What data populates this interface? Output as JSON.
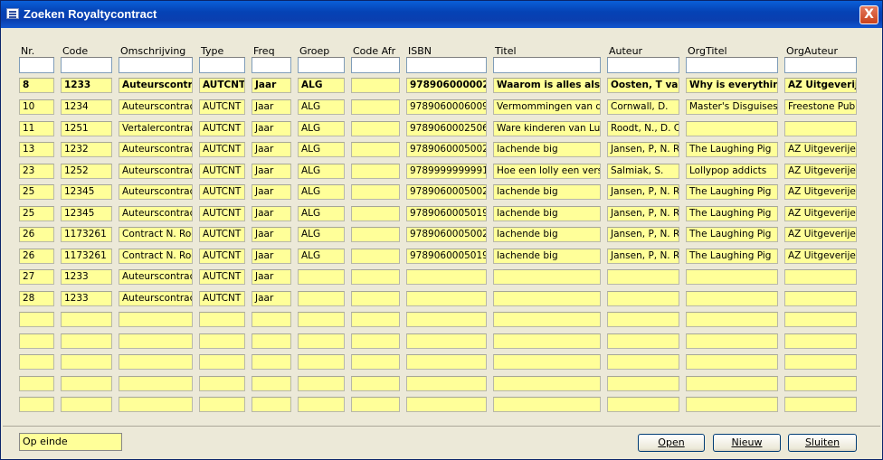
{
  "window": {
    "title": "Zoeken Royaltycontract",
    "close_label": "X"
  },
  "columns": [
    "Nr.",
    "Code",
    "Omschrijving",
    "Type",
    "Freq",
    "Groep",
    "Code Afr",
    "ISBN",
    "Titel",
    "Auteur",
    "OrgTitel",
    "OrgAuteur"
  ],
  "filters": [
    "",
    "",
    "",
    "",
    "",
    "",
    "",
    "",
    "",
    "",
    "",
    ""
  ],
  "current_row": [
    "8",
    "1233",
    "Auteurscontra",
    "AUTCNT",
    "Jaar",
    "ALG",
    "",
    "978906000002",
    "Waarom is alles als h",
    "Oosten, T van",
    "Why is everything",
    "AZ Uitgeverij"
  ],
  "rows": [
    [
      "10",
      "1234",
      "Auteurscontract",
      "AUTCNT",
      "Jaar",
      "ALG",
      "",
      "9789060006009",
      "Vermommingen van de m",
      "Cornwall, D.",
      "Master's Disguises",
      "Freestone Publis"
    ],
    [
      "11",
      "1251",
      "Vertalercontrac",
      "AUTCNT",
      "Jaar",
      "ALG",
      "",
      "9789060002506",
      "Ware kinderen van Lund",
      "Roodt, N., D. Cc",
      "",
      ""
    ],
    [
      "13",
      "1232",
      "Auteurscontract",
      "AUTCNT",
      "Jaar",
      "ALG",
      "",
      "9789060005002",
      "lachende big",
      "Jansen, P, N. Ro",
      "The Laughing Pig",
      "AZ Uitgeverijen"
    ],
    [
      "23",
      "1252",
      "Auteurscontract",
      "AUTCNT",
      "Jaar",
      "ALG",
      "",
      "9789999999991",
      "Hoe een lolly een versla",
      "Salmiak, S.",
      "Lollypop addicts",
      "AZ Uitgeverijen"
    ],
    [
      "25",
      "12345",
      "Auteurscontract",
      "AUTCNT",
      "Jaar",
      "ALG",
      "",
      "9789060005002",
      "lachende big",
      "Jansen, P, N. Ro",
      "The Laughing Pig",
      "AZ Uitgeverijen"
    ],
    [
      "25",
      "12345",
      "Auteurscontract",
      "AUTCNT",
      "Jaar",
      "ALG",
      "",
      "9789060005019",
      "lachende big",
      "Jansen, P, N. Ro",
      "The Laughing Pig",
      "AZ Uitgeverijen"
    ],
    [
      "26",
      "1173261",
      "Contract N. Roo",
      "AUTCNT",
      "Jaar",
      "ALG",
      "",
      "9789060005002",
      "lachende big",
      "Jansen, P, N. Ro",
      "The Laughing Pig",
      "AZ Uitgeverijen"
    ],
    [
      "26",
      "1173261",
      "Contract N. Roo",
      "AUTCNT",
      "Jaar",
      "ALG",
      "",
      "9789060005019",
      "lachende big",
      "Jansen, P, N. Ro",
      "The Laughing Pig",
      "AZ Uitgeverijen"
    ],
    [
      "27",
      "1233",
      "Auteurscontract",
      "AUTCNT",
      "Jaar",
      "",
      "",
      "",
      "",
      "",
      "",
      ""
    ],
    [
      "28",
      "1233",
      "Auteurscontract",
      "AUTCNT",
      "Jaar",
      "",
      "",
      "",
      "",
      "",
      "",
      ""
    ],
    [
      "",
      "",
      "",
      "",
      "",
      "",
      "",
      "",
      "",
      "",
      "",
      ""
    ],
    [
      "",
      "",
      "",
      "",
      "",
      "",
      "",
      "",
      "",
      "",
      "",
      ""
    ],
    [
      "",
      "",
      "",
      "",
      "",
      "",
      "",
      "",
      "",
      "",
      "",
      ""
    ],
    [
      "",
      "",
      "",
      "",
      "",
      "",
      "",
      "",
      "",
      "",
      "",
      ""
    ],
    [
      "",
      "",
      "",
      "",
      "",
      "",
      "",
      "",
      "",
      "",
      "",
      ""
    ]
  ],
  "status": "Op einde",
  "buttons": {
    "open": "Open",
    "new": "Nieuw",
    "close": "Sluiten"
  }
}
